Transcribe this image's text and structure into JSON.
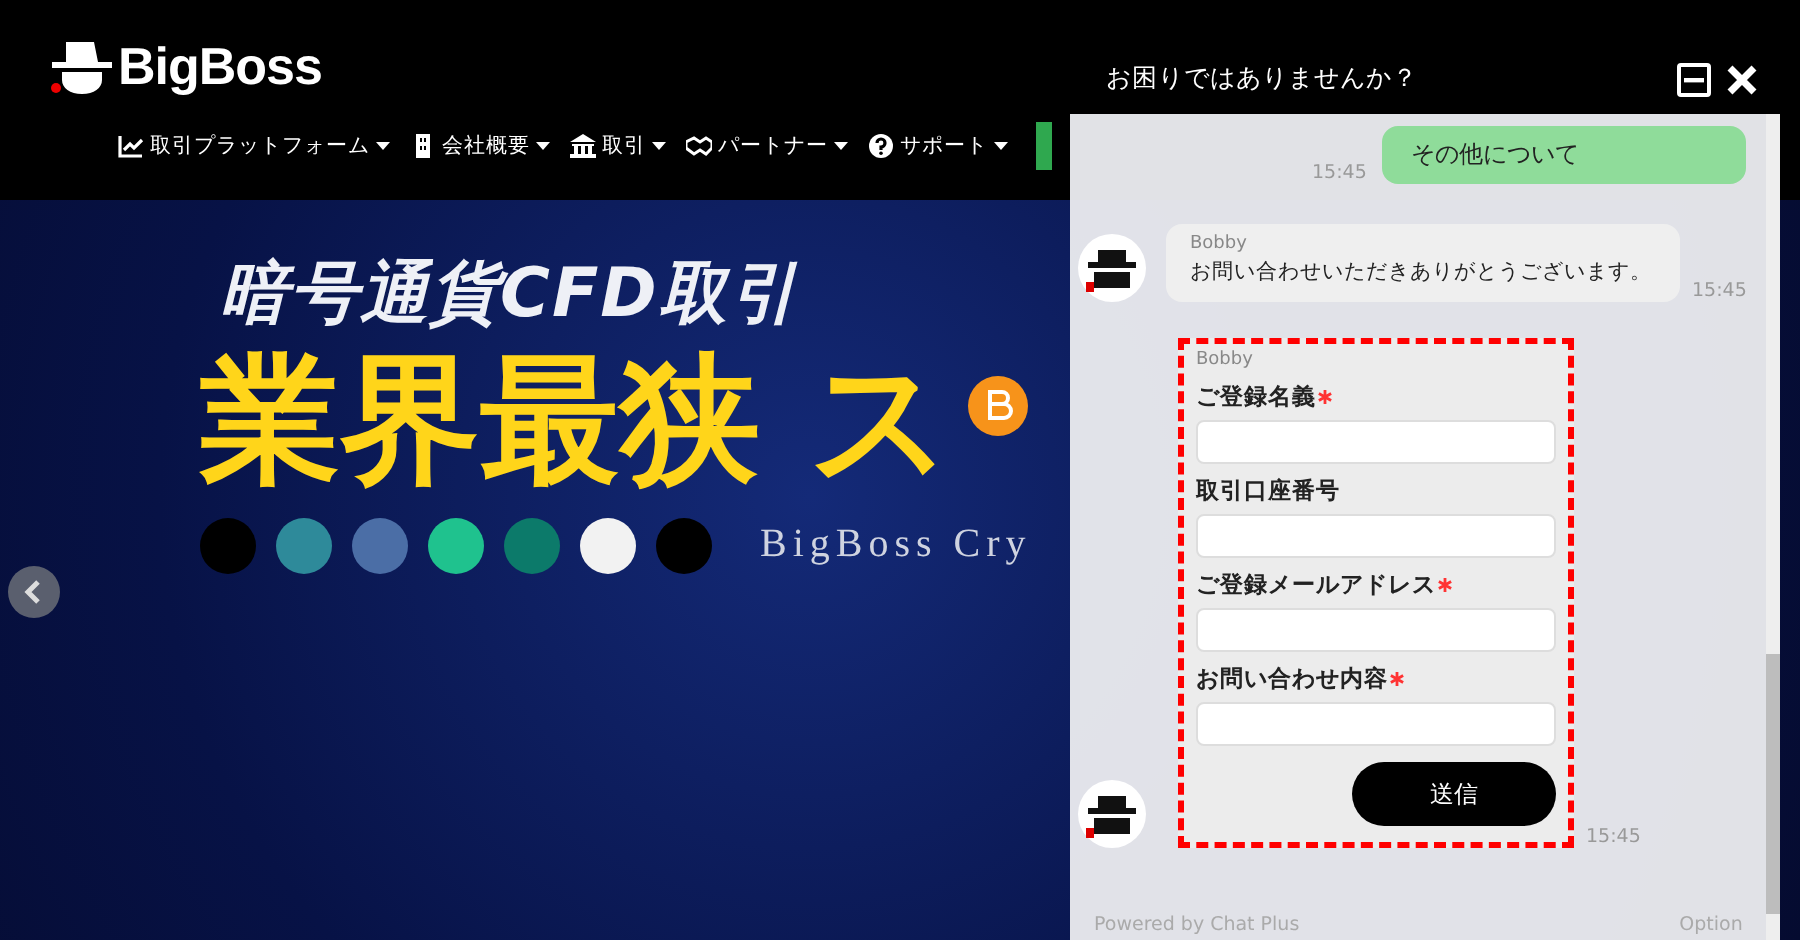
{
  "header": {
    "logo": "BigBoss",
    "nav": [
      {
        "label": "取引プラットフォーム"
      },
      {
        "label": "会社概要"
      },
      {
        "label": "取引"
      },
      {
        "label": "パートナー"
      },
      {
        "label": "サポート"
      }
    ]
  },
  "banner": {
    "subtitle": "暗号通貨CFD取引",
    "headline": "業界最狭 ス",
    "tagline": "BigBoss Cry",
    "coins": [
      {
        "color": "#000000"
      },
      {
        "color": "#2e8a9a"
      },
      {
        "color": "#4b6ea6"
      },
      {
        "color": "#1fc28e"
      },
      {
        "color": "#0c7a6a"
      },
      {
        "color": "#f2f2f2"
      },
      {
        "color": "#000000"
      }
    ]
  },
  "chat": {
    "title": "お困りではありませんか？",
    "messages": [
      {
        "kind": "user",
        "text": "その他について",
        "time": "15:45"
      },
      {
        "kind": "bot",
        "sender": "Bobby",
        "text": "お問い合わせいただきありがとうございます。",
        "time": "15:45"
      }
    ],
    "form": {
      "sender": "Bobby",
      "time": "15:45",
      "submit": "送信",
      "fields": [
        {
          "label": "ご登録名義",
          "required": true
        },
        {
          "label": "取引口座番号",
          "required": false
        },
        {
          "label": "ご登録メールアドレス",
          "required": true
        },
        {
          "label": "お問い合わせ内容",
          "required": true
        }
      ]
    },
    "footer": {
      "powered": "Powered by Chat Plus",
      "option": "Option"
    }
  }
}
